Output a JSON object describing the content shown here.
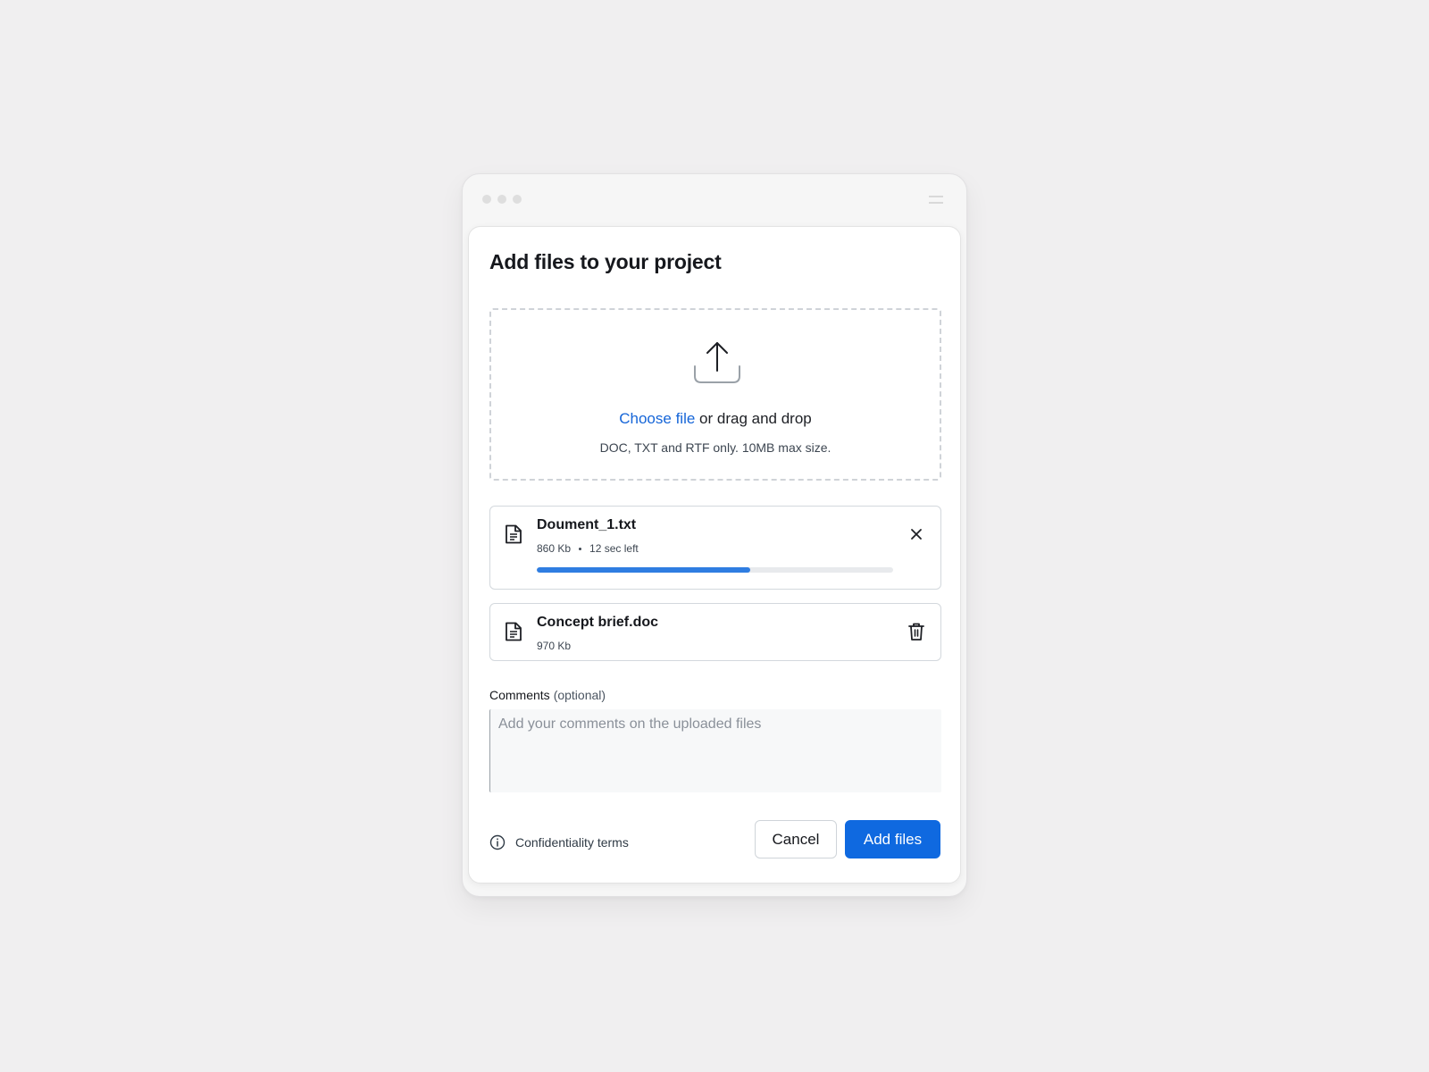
{
  "dialog": {
    "title": "Add files to your project"
  },
  "dropzone": {
    "link_text": "Choose file",
    "text": " or drag and drop",
    "hint": "DOC, TXT and RTF only. 10MB max size."
  },
  "files": [
    {
      "name": "Doument_1.txt",
      "size": "860 Kb",
      "time_left": "12 sec left",
      "progress": 0.6,
      "action_icon": "close-icon"
    },
    {
      "name": "Concept brief.doc",
      "size": "970 Kb",
      "action_icon": "trash-icon"
    }
  ],
  "comments": {
    "label": "Comments",
    "optional": "(optional)",
    "placeholder": "Add your comments on the uploaded files",
    "value": ""
  },
  "footer": {
    "terms_label": "Confidentiality terms",
    "cancel_label": "Cancel",
    "add_label": "Add files"
  },
  "colors": {
    "accent": "#0f69e0",
    "progress": "#2f7de1",
    "link": "#1565d8"
  }
}
